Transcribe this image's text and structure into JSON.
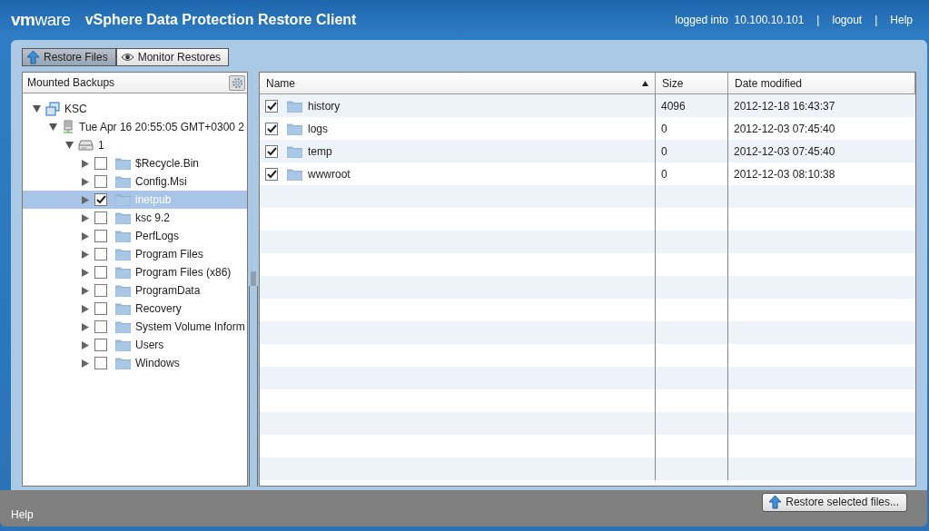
{
  "header": {
    "logo_prefix": "vm",
    "logo_suffix": "ware",
    "title": "vSphere Data Protection Restore Client",
    "login_info": "logged into  10.100.10.101",
    "links": [
      {
        "separator": "|",
        "label": "logout"
      },
      {
        "separator": "|",
        "label": "Help"
      }
    ]
  },
  "tabs": [
    {
      "label": "Restore Files",
      "selected": true
    },
    {
      "label": "Monitor Restores",
      "selected": false
    }
  ],
  "tree": {
    "title": "Mounted Backups",
    "items": [
      {
        "label": "KSC",
        "kind": "vm",
        "expanded": true,
        "children": [
          {
            "label": "Tue Apr 16 20:55:05 GMT+0300 2",
            "kind": "server",
            "expanded": true,
            "children": [
              {
                "label": "1",
                "kind": "disk",
                "expanded": true,
                "children": [
                  {
                    "label": "$Recycle.Bin",
                    "kind": "folder",
                    "expanded": false,
                    "checked": false,
                    "selected": false
                  },
                  {
                    "label": "Config.Msi",
                    "kind": "folder",
                    "expanded": false,
                    "checked": false,
                    "selected": false
                  },
                  {
                    "label": "inetpub",
                    "kind": "folder",
                    "expanded": false,
                    "checked": true,
                    "selected": true
                  },
                  {
                    "label": "ksc 9.2",
                    "kind": "folder",
                    "expanded": false,
                    "checked": false,
                    "selected": false
                  },
                  {
                    "label": "PerfLogs",
                    "kind": "folder",
                    "expanded": false,
                    "checked": false,
                    "selected": false
                  },
                  {
                    "label": "Program Files",
                    "kind": "folder",
                    "expanded": false,
                    "checked": false,
                    "selected": false
                  },
                  {
                    "label": "Program Files (x86)",
                    "kind": "folder",
                    "expanded": false,
                    "checked": false,
                    "selected": false
                  },
                  {
                    "label": "ProgramData",
                    "kind": "folder",
                    "expanded": false,
                    "checked": false,
                    "selected": false
                  },
                  {
                    "label": "Recovery",
                    "kind": "folder",
                    "expanded": false,
                    "checked": false,
                    "selected": false
                  },
                  {
                    "label": "System Volume Inform",
                    "kind": "folder",
                    "expanded": false,
                    "checked": false,
                    "selected": false
                  },
                  {
                    "label": "Users",
                    "kind": "folder",
                    "expanded": false,
                    "checked": false,
                    "selected": false
                  },
                  {
                    "label": "Windows",
                    "kind": "folder",
                    "expanded": false,
                    "checked": false,
                    "selected": false
                  }
                ]
              }
            ]
          }
        ]
      }
    ]
  },
  "table": {
    "columns": [
      {
        "label": "Name",
        "sorted": true
      },
      {
        "label": "Size",
        "sorted": false
      },
      {
        "label": "Date modified",
        "sorted": false
      }
    ],
    "rows": [
      {
        "checked": true,
        "name": "history",
        "size": "4096",
        "date": "2012-12-18 16:43:37"
      },
      {
        "checked": true,
        "name": "logs",
        "size": "0",
        "date": "2012-12-03 07:45:40"
      },
      {
        "checked": true,
        "name": "temp",
        "size": "0",
        "date": "2012-12-03 07:45:40"
      },
      {
        "checked": true,
        "name": "wwwroot",
        "size": "0",
        "date": "2012-12-03 08:10:38"
      }
    ]
  },
  "footer": {
    "help": "Help",
    "restore_button": "Restore selected files..."
  }
}
